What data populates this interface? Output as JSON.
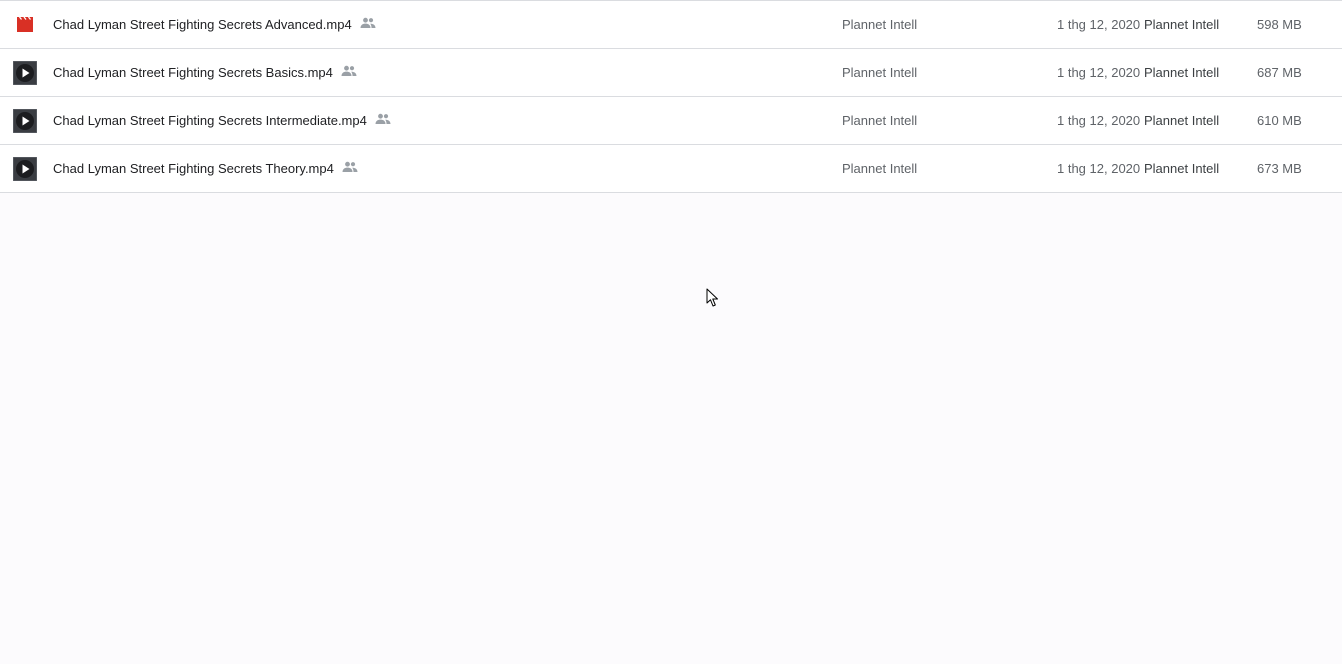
{
  "files": [
    {
      "name": "Chad Lyman Street Fighting Secrets Advanced.mp4",
      "thumbnail_icon": "video-clapperboard-icon",
      "shared": true,
      "owner": "Plannet Intell",
      "modified": "1 thg 12, 2020",
      "modified_by": "Plannet Intell",
      "size": "598 MB"
    },
    {
      "name": "Chad Lyman Street Fighting Secrets Basics.mp4",
      "thumbnail_icon": "video-thumbnail-play-icon",
      "shared": true,
      "owner": "Plannet Intell",
      "modified": "1 thg 12, 2020",
      "modified_by": "Plannet Intell",
      "size": "687 MB"
    },
    {
      "name": "Chad Lyman Street Fighting Secrets Intermediate.mp4",
      "thumbnail_icon": "video-thumbnail-play-icon",
      "shared": true,
      "owner": "Plannet Intell",
      "modified": "1 thg 12, 2020",
      "modified_by": "Plannet Intell",
      "size": "610 MB"
    },
    {
      "name": "Chad Lyman Street Fighting Secrets Theory.mp4",
      "thumbnail_icon": "video-thumbnail-play-icon",
      "shared": true,
      "owner": "Plannet Intell",
      "modified": "1 thg 12, 2020",
      "modified_by": "Plannet Intell",
      "size": "673 MB"
    }
  ],
  "colors": {
    "clapperboard_red": "#d93025",
    "shared_icon": "#9aa0a6",
    "divider": "#dadce0"
  }
}
